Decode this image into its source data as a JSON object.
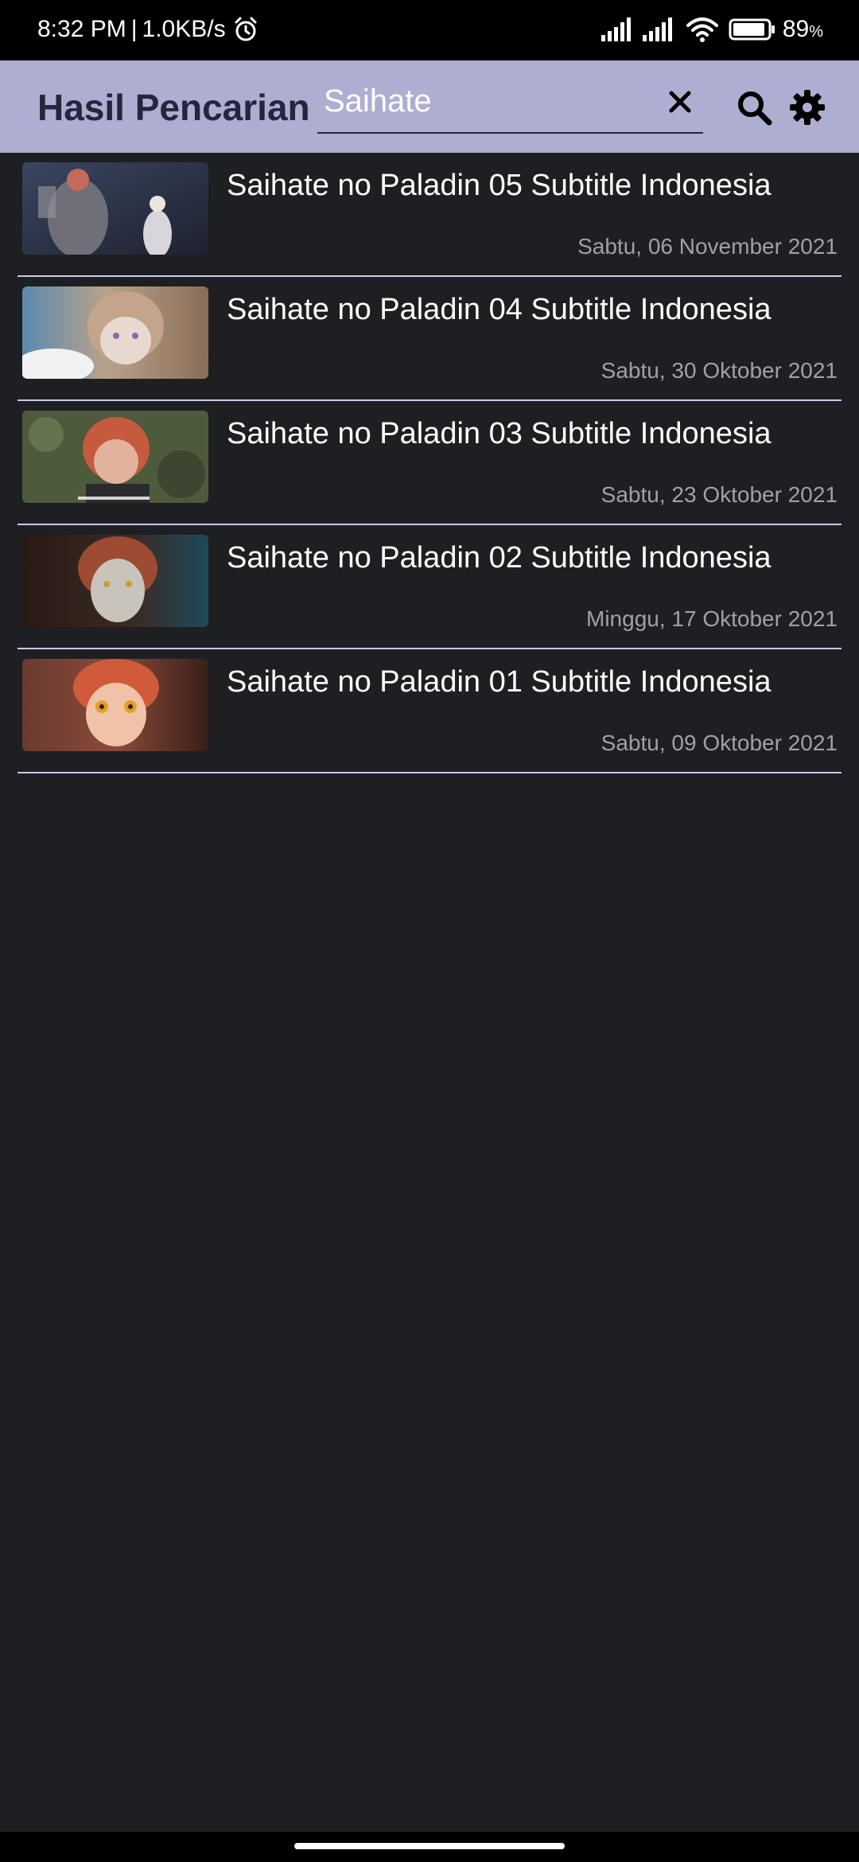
{
  "status_bar": {
    "time": "8:32 PM",
    "separator": "|",
    "speed": "1.0KB/s",
    "alarm_icon": "alarm-clock-icon",
    "signal_icon": "signal-bars-icon",
    "wifi_icon": "wifi-icon",
    "battery_icon": "battery-icon",
    "battery_level": "89",
    "battery_unit": "%"
  },
  "header": {
    "title": "Hasil Pencarian",
    "search_value": "Saihate",
    "clear_icon": "close-icon",
    "search_icon": "search-icon",
    "settings_icon": "gear-icon",
    "accent_color": "#aeaed3",
    "title_color": "#25253d"
  },
  "results": [
    {
      "title": "Saihate no Paladin 05 Subtitle Indonesia",
      "date": "Sabtu, 06 November 2021",
      "thumbnail": "anime-screenshot-thumbnail"
    },
    {
      "title": "Saihate no Paladin 04 Subtitle Indonesia",
      "date": "Sabtu, 30 Oktober 2021",
      "thumbnail": "anime-screenshot-thumbnail"
    },
    {
      "title": "Saihate no Paladin 03 Subtitle Indonesia",
      "date": "Sabtu, 23 Oktober 2021",
      "thumbnail": "anime-screenshot-thumbnail"
    },
    {
      "title": "Saihate no Paladin 02 Subtitle Indonesia",
      "date": "Minggu, 17 Oktober 2021",
      "thumbnail": "anime-screenshot-thumbnail"
    },
    {
      "title": "Saihate no Paladin 01 Subtitle Indonesia",
      "date": "Sabtu, 09 Oktober 2021",
      "thumbnail": "anime-screenshot-thumbnail"
    }
  ],
  "theme": {
    "background": "#1e1f23",
    "divider": "#c9c9ec",
    "date_color": "#a0a0a5"
  }
}
